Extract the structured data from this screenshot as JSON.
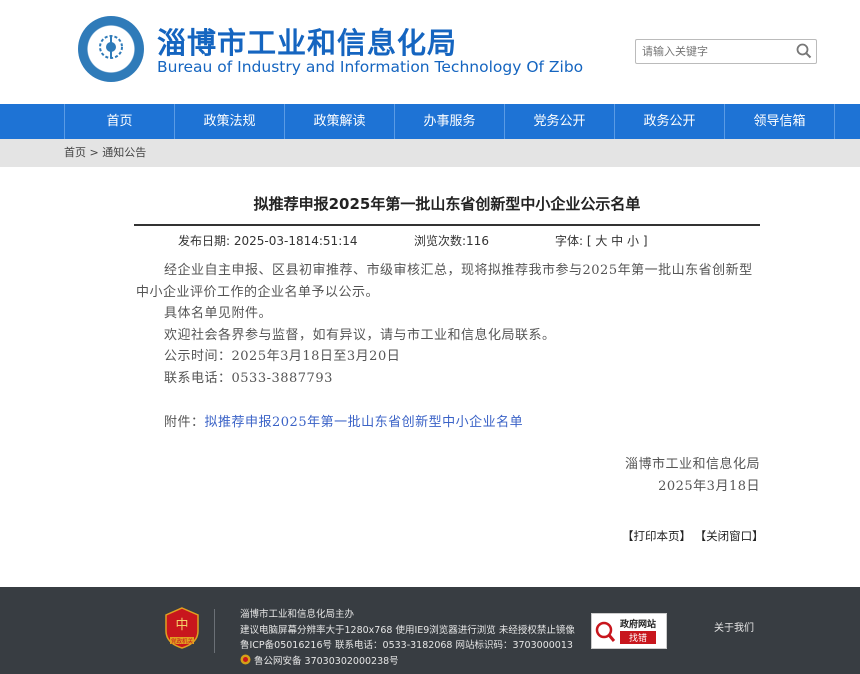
{
  "header": {
    "title_cn": "淄博市工业和信息化局",
    "title_en": "Bureau of Industry and Information Technology Of Zibo",
    "search_placeholder": "请输入关键字"
  },
  "nav": {
    "items": [
      "首页",
      "政策法规",
      "政策解读",
      "办事服务",
      "党务公开",
      "政务公开",
      "领导信箱"
    ]
  },
  "breadcrumb": {
    "home": "首页",
    "sep": ">",
    "current": "通知公告"
  },
  "article": {
    "title": "拟推荐申报2025年第一批山东省创新型中小企业公示名单",
    "publish_label": "发布日期:",
    "publish_value": "2025-03-1814:51:14",
    "views_label": "浏览次数:",
    "views_value": "116",
    "font_label": "字体:",
    "font_options": "[ 大 中 小 ]",
    "para1": "经企业自主申报、区县初审推荐、市级审核汇总，现将拟推荐我市参与2025年第一批山东省创新型中小企业评价工作的企业名单予以公示。",
    "para2": "具体名单见附件。",
    "para3": "欢迎社会各界参与监督，如有异议，请与市工业和信息化局联系。",
    "para4": "公示时间：2025年3月18日至3月20日",
    "para5": "联系电话：0533-3887793",
    "attach_label": "附件：",
    "attach_link": "拟推荐申报2025年第一批山东省创新型中小企业名单",
    "sign_org": "淄博市工业和信息化局",
    "sign_date": "2025年3月18日",
    "print_label": "【打印本页】",
    "close_label": "【关闭窗口】"
  },
  "footer": {
    "line1": "淄博市工业和信息化局主办",
    "line2": "建议电脑屏幕分辨率大于1280x768 使用IE9浏览器进行浏览 未经授权禁止镜像",
    "line3": "鲁ICP备05016216号 联系电话：0533-3182068 网站标识码：3703000013",
    "line4": "鲁公网安备 37030302000238号",
    "emblem_text": "党政机关",
    "badge_top": "政府网站",
    "badge_bottom": "找错",
    "about": "关于我们"
  },
  "colors": {
    "brand_blue": "#1565c0",
    "nav_blue": "#1e73d5",
    "footer_bg": "#383d42",
    "link_blue": "#3b63c7"
  }
}
